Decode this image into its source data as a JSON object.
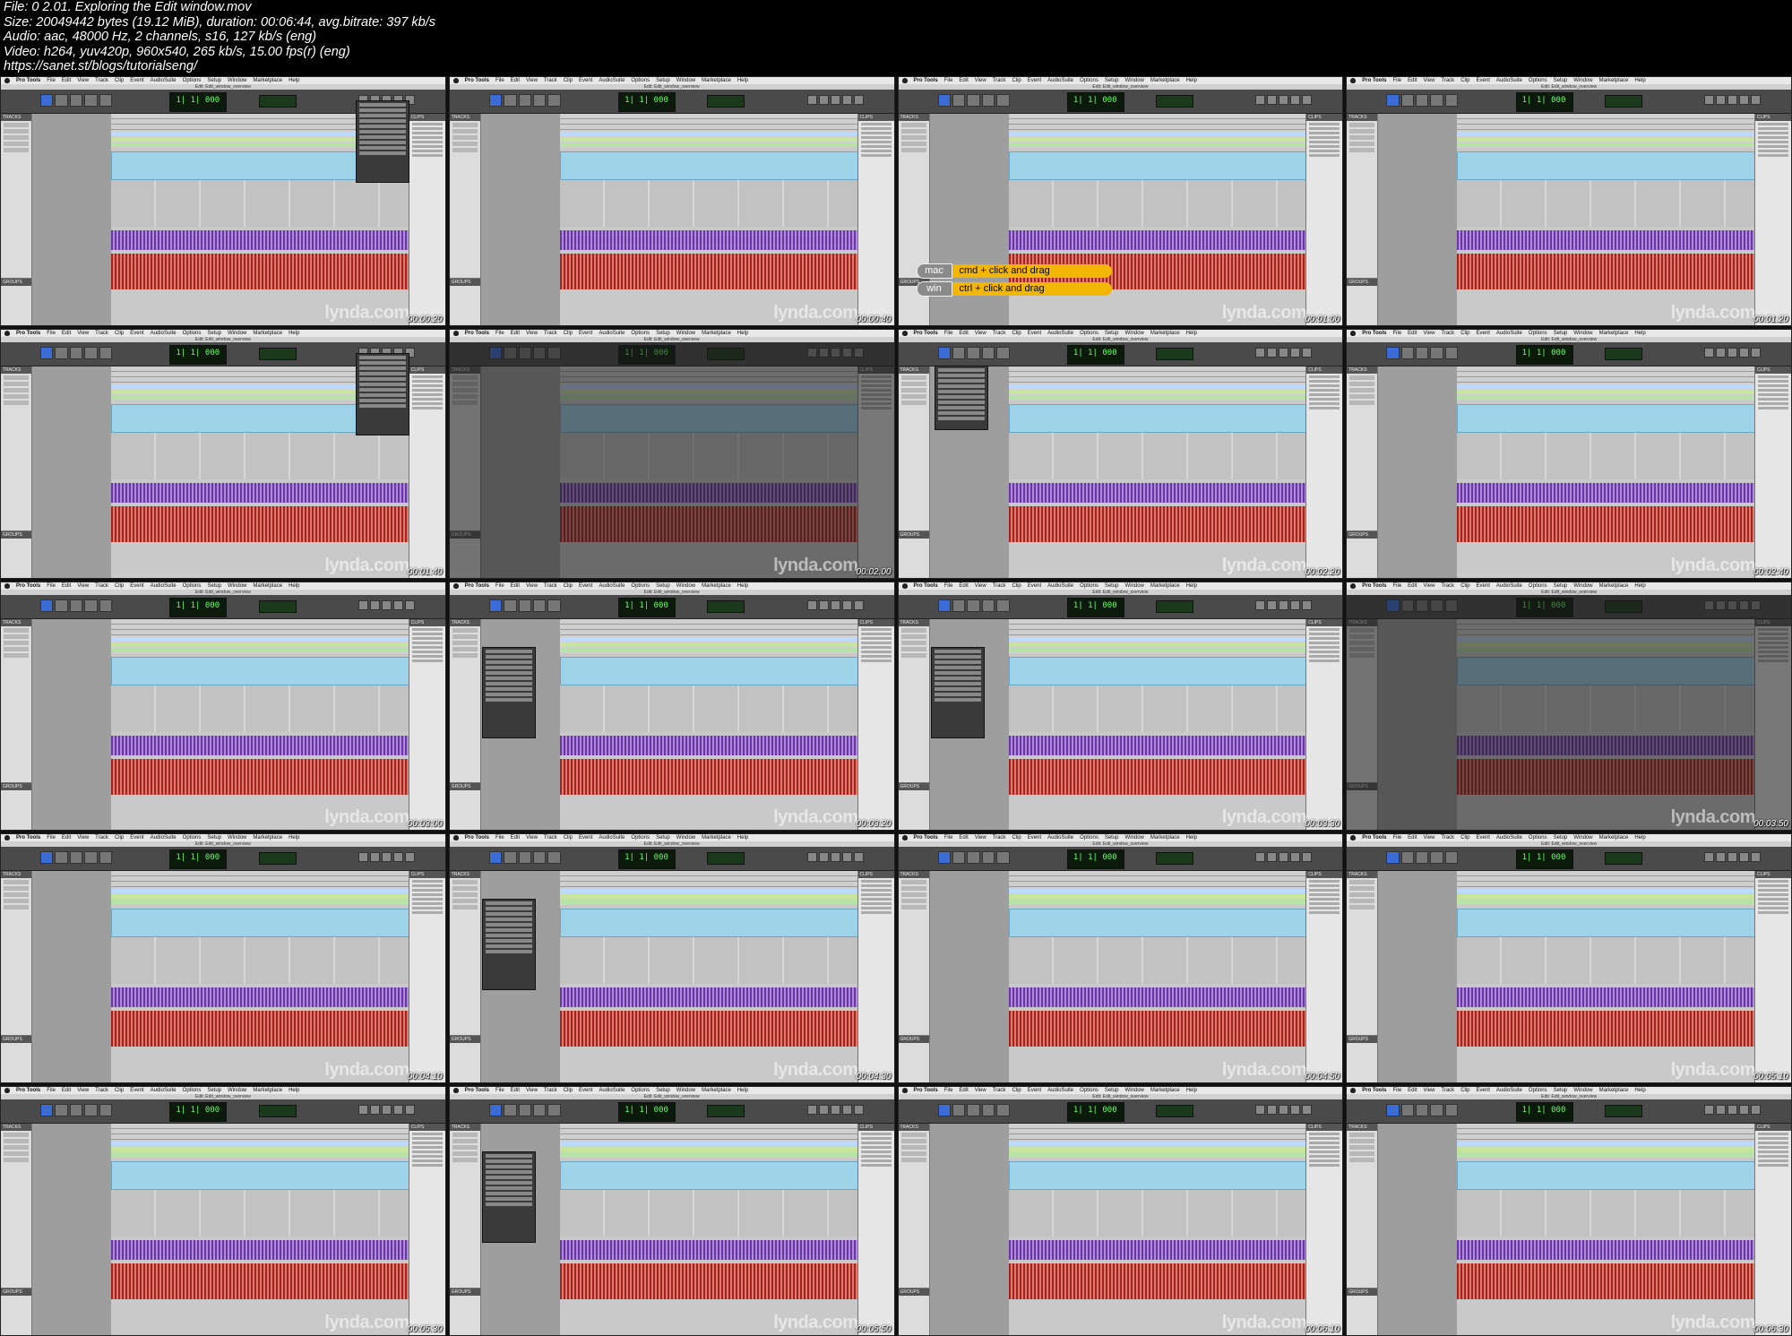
{
  "file_info": {
    "line1": "File: 0 2.01. Exploring the Edit window.mov",
    "line2": "Size: 20049442 bytes (19.12 MiB), duration: 00:06:44, avg.bitrate: 397 kb/s",
    "line3": "Audio: aac, 48000 Hz, 2 channels, s16, 127 kb/s (eng)",
    "line4": "Video: h264, yuv420p, 960x540, 265 kb/s, 15.00 fps(r) (eng)",
    "line5": "https://sanet.st/blogs/tutorialseng/"
  },
  "app": {
    "menu": [
      "Pro Tools",
      "File",
      "Edit",
      "View",
      "Track",
      "Clip",
      "Event",
      "AudioSuite",
      "Options",
      "Setup",
      "Window",
      "Marketplace",
      "Help"
    ],
    "window_title": "Edit: Edit_window_overview",
    "counter": "1| 1| 000",
    "tracks_header": "TRACKS",
    "groups_header": "GROUPS",
    "clips_header": "CLIPS",
    "watermark": "lynda.com"
  },
  "shortcut_overlay": {
    "mac_label": "mac",
    "mac_shortcut": "cmd + click and drag",
    "win_label": "win",
    "win_shortcut": "ctrl + click and drag"
  },
  "thumbnails": [
    {
      "time": "00:00:20",
      "state": "menu-r"
    },
    {
      "time": "00:00:40",
      "state": "normal"
    },
    {
      "time": "00:01:00",
      "state": "keys"
    },
    {
      "time": "00:01:20",
      "state": "normal"
    },
    {
      "time": "00:01:40",
      "state": "menu-r"
    },
    {
      "time": "00:02:00",
      "state": "dim"
    },
    {
      "time": "00:02:20",
      "state": "menu-c"
    },
    {
      "time": "00:02:40",
      "state": "normal"
    },
    {
      "time": "00:03:00",
      "state": "normal"
    },
    {
      "time": "00:03:20",
      "state": "menu-l"
    },
    {
      "time": "00:03:30",
      "state": "menu-l"
    },
    {
      "time": "00:03:50",
      "state": "dim"
    },
    {
      "time": "00:04:10",
      "state": "normal"
    },
    {
      "time": "00:04:30",
      "state": "menu-l"
    },
    {
      "time": "00:04:50",
      "state": "normal"
    },
    {
      "time": "00:05:10",
      "state": "normal"
    },
    {
      "time": "00:05:30",
      "state": "normal"
    },
    {
      "time": "00:05:50",
      "state": "menu-l"
    },
    {
      "time": "00:06:10",
      "state": "normal"
    },
    {
      "time": "00:06:30",
      "state": "normal"
    }
  ]
}
